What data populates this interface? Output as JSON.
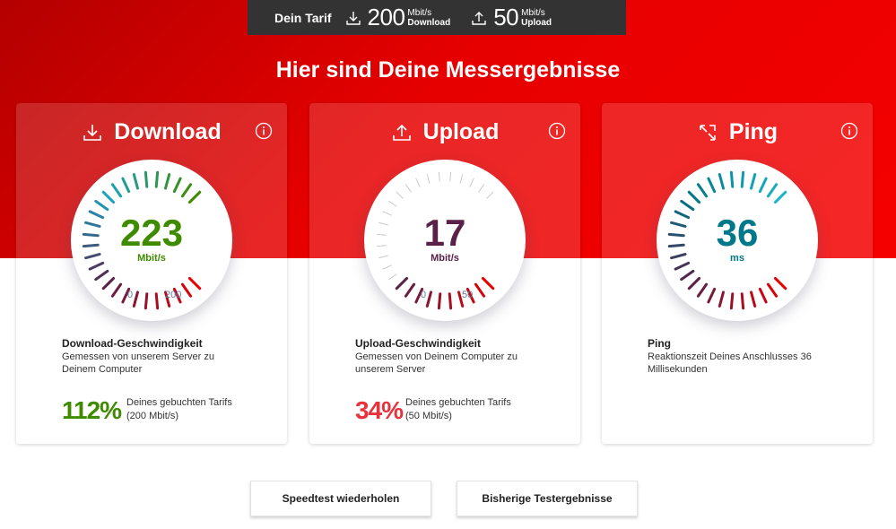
{
  "tarif": {
    "label": "Dein Tarif",
    "download_value": "200",
    "download_unit": "Mbit/s",
    "download_label": "Download",
    "upload_value": "50",
    "upload_unit": "Mbit/s",
    "upload_label": "Upload"
  },
  "headline": "Hier sind Deine Messergebnisse",
  "cards": {
    "download": {
      "title": "Download",
      "value": "223",
      "unit": "Mbit/s",
      "scale_min": "0",
      "scale_max": "200",
      "desc_title": "Download-Geschwindigkeit",
      "desc_text": "Gemessen von unserem Server zu Deinem Computer",
      "percent": "112%",
      "percent_line1": "Deines gebuchten Tarifs",
      "percent_line2": "(200 Mbit/s)"
    },
    "upload": {
      "title": "Upload",
      "value": "17",
      "unit": "Mbit/s",
      "scale_min": "0",
      "scale_max": "50",
      "desc_title": "Upload-Geschwindigkeit",
      "desc_text": "Gemessen von Deinem Computer zu unserem Server",
      "percent": "34%",
      "percent_line1": "Deines gebuchten Tarifs",
      "percent_line2": "(50 Mbit/s)"
    },
    "ping": {
      "title": "Ping",
      "value": "36",
      "unit": "ms",
      "desc_title": "Ping",
      "desc_text": "Reaktionszeit Deines Anschlusses 36 Millisekunden"
    }
  },
  "buttons": {
    "repeat": "Speedtest wiederholen",
    "history": "Bisherige Testergebnisse"
  },
  "gauges": {
    "download_fill": 1.0,
    "upload_fill": 0.34,
    "ping_fill": 1.0
  },
  "colors": {
    "brand_red": "#e60000",
    "download_green": "#3e8b00",
    "upload_purple": "#5a2148",
    "ping_teal": "#00788a",
    "pct_good": "#3e8b00",
    "pct_bad": "#e8313a"
  }
}
